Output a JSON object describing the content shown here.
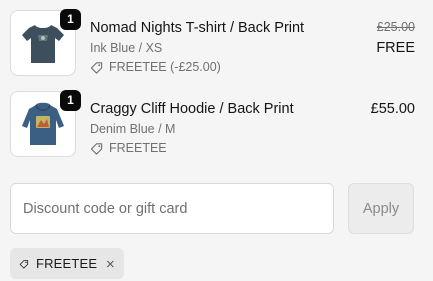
{
  "cart": {
    "items": [
      {
        "title": "Nomad Nights T-shirt / Back Print",
        "variant": "Ink Blue / XS",
        "discount": "FREETEE (-£25.00)",
        "quantity": "1",
        "original_price": "£25.00",
        "price": "FREE",
        "thumbnail_icon": "tshirt-icon",
        "thumbnail_color": "#3d4e5c"
      },
      {
        "title": "Craggy Cliff Hoodie / Back Print",
        "variant": "Denim Blue / M",
        "discount": "FREETEE",
        "quantity": "1",
        "price": "£55.00",
        "thumbnail_icon": "hoodie-icon",
        "thumbnail_color": "#3b5f82"
      }
    ]
  },
  "discount_form": {
    "placeholder": "Discount code or gift card",
    "value": "",
    "apply_label": "Apply"
  },
  "applied_discount": {
    "code": "FREETEE",
    "icon": "tag-icon",
    "remove_icon": "close-icon"
  },
  "colors": {
    "background": "#f5f5f5",
    "badge": "#0a0a0a",
    "chip_bg": "#e6e6e6",
    "muted_text": "#707070"
  }
}
